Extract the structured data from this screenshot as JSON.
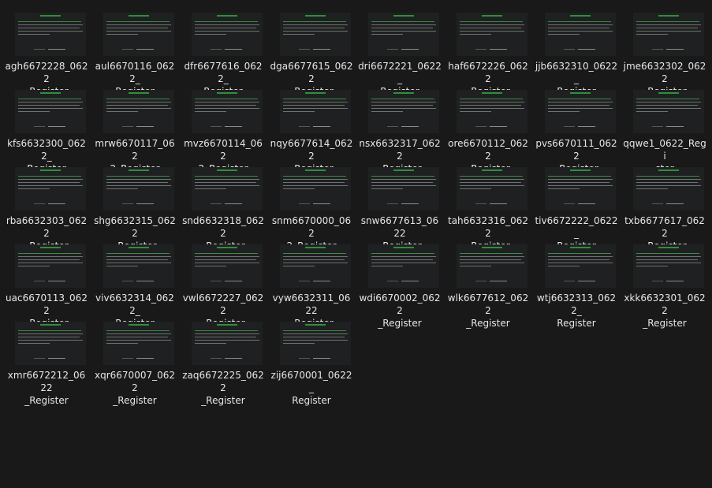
{
  "thumbnail": {
    "title": "Account prompt",
    "body_lines": 5
  },
  "files": [
    "agh6672228_0622_Register",
    "aul6670116_0622_Register",
    "dfr6677616_0622_Register",
    "dga6677615_0622_Register",
    "dri6672221_0622_Register",
    "haf6672226_0622_Register",
    "jjb6632310_0622_Register",
    "jme6632302_0622_Register",
    "kfs6632300_0622_Register",
    "mrw6670117_0622_Register",
    "mvz6670114_0622_Register",
    "nqy6677614_0622_Register",
    "nsx6632317_0622_Register",
    "ore6670112_0622_Register",
    "pvs6670111_0622_Register",
    "qqwe1_0622_Register",
    "rba6632303_0622_Register",
    "shg6632315_0622_Register",
    "snd6632318_0622_Register",
    "snm6670000_0622_Register",
    "snw6677613_0622_Register",
    "tah6632316_0622_Register",
    "tiv6672222_0622_Register",
    "txb6677617_0622_Register",
    "uac6670113_0622_Register",
    "viv6632314_0622_Register",
    "vwl6672227_0622_Register",
    "vyw6632311_0622_Register",
    "wdi6670002_0622_Register",
    "wlk6677612_0622_Register",
    "wtj6632313_0622_Register",
    "xkk6632301_0622_Register",
    "xmr6672212_0622_Register",
    "xqr6670007_0622_Register",
    "zaq6672225_0622_Register",
    "zij6670001_0622_Register"
  ],
  "label_lines": [
    [
      "agh6672228_0622",
      "_Register"
    ],
    [
      "aul6670116_0622_",
      "Register"
    ],
    [
      "dfr6677616_0622_",
      "Register"
    ],
    [
      "dga6677615_0622",
      "_Register"
    ],
    [
      "dri6672221_0622_",
      "Register"
    ],
    [
      "haf6672226_0622",
      "_Register"
    ],
    [
      "jjb6632310_0622_",
      "Register"
    ],
    [
      "jme6632302_0622",
      "_Register"
    ],
    [
      "kfs6632300_0622_",
      "Register"
    ],
    [
      "mrw6670117_062",
      "2_Register"
    ],
    [
      "mvz6670114_062",
      "2_Register"
    ],
    [
      "nqy6677614_0622",
      "_Register"
    ],
    [
      "nsx6632317_0622",
      "_Register"
    ],
    [
      "ore6670112_0622",
      "_Register"
    ],
    [
      "pvs6670111_0622",
      "_Register"
    ],
    [
      "qqwe1_0622_Regi",
      "ster"
    ],
    [
      "rba6632303_0622",
      "_Register"
    ],
    [
      "shg6632315_0622",
      "_Register"
    ],
    [
      "snd6632318_0622",
      "_Register"
    ],
    [
      "snm6670000_062",
      "2_Register"
    ],
    [
      "snw6677613_0622",
      "_Register"
    ],
    [
      "tah6632316_0622",
      "_Register"
    ],
    [
      "tiv6672222_0622_",
      "Register"
    ],
    [
      "txb6677617_0622",
      "_Register"
    ],
    [
      "uac6670113_0622",
      "_Register"
    ],
    [
      "viv6632314_0622_",
      "Register"
    ],
    [
      "vwl6672227_0622",
      "_Register"
    ],
    [
      "vyw6632311_0622",
      "_Register"
    ],
    [
      "wdi6670002_0622",
      "_Register"
    ],
    [
      "wlk6677612_0622",
      "_Register"
    ],
    [
      "wtj6632313_0622_",
      "Register"
    ],
    [
      "xkk6632301_0622",
      "_Register"
    ],
    [
      "xmr6672212_0622",
      "_Register"
    ],
    [
      "xqr6670007_0622",
      "_Register"
    ],
    [
      "zaq6672225_0622",
      "_Register"
    ],
    [
      "zij6670001_0622_",
      "Register"
    ]
  ],
  "colors": {
    "background": "#191919",
    "thumbnail_bg": "#1f2021",
    "thumbnail_accent": "#2f8f3a",
    "label_text": "#e6e6e6"
  }
}
